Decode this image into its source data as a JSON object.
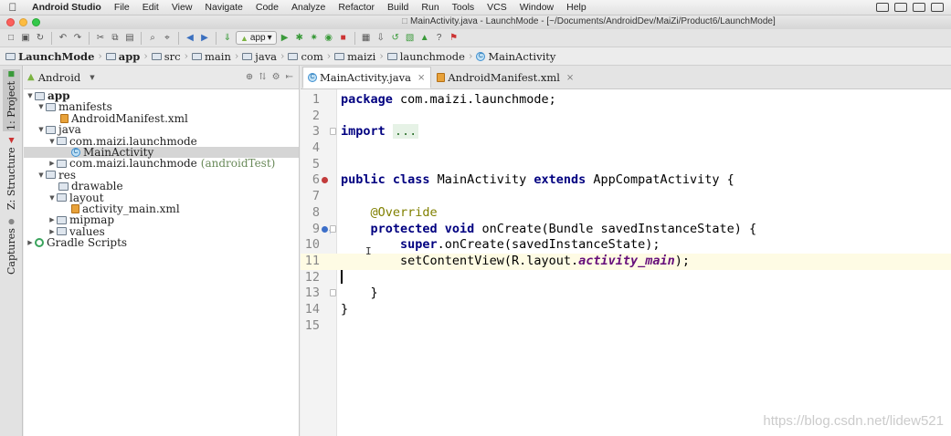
{
  "menubar": {
    "app_name": "Android Studio",
    "items": [
      "File",
      "Edit",
      "View",
      "Navigate",
      "Code",
      "Analyze",
      "Refactor",
      "Build",
      "Run",
      "Tools",
      "VCS",
      "Window",
      "Help"
    ]
  },
  "window": {
    "title": "MainActivity.java - LaunchMode - [~/Documents/AndroidDev/MaiZi/Product6/LaunchMode]"
  },
  "toolbar": {
    "run_config": "app"
  },
  "breadcrumb": [
    "LaunchMode",
    "app",
    "src",
    "main",
    "java",
    "com",
    "maizi",
    "launchmode",
    "MainActivity"
  ],
  "left_stripe": {
    "tabs": [
      "1: Project",
      "Z: Structure",
      "Captures"
    ]
  },
  "project_panel": {
    "view_mode": "Android",
    "tree": [
      {
        "label": "app",
        "depth": 0
      },
      {
        "label": "manifests",
        "depth": 1
      },
      {
        "label": "AndroidManifest.xml",
        "depth": 2
      },
      {
        "label": "java",
        "depth": 1
      },
      {
        "label": "com.maizi.launchmode",
        "depth": 2
      },
      {
        "label": "MainActivity",
        "depth": 3
      },
      {
        "label": "com.maizi.launchmode",
        "suffix": "(androidTest)",
        "depth": 2
      },
      {
        "label": "res",
        "depth": 1
      },
      {
        "label": "drawable",
        "depth": 2
      },
      {
        "label": "layout",
        "depth": 2
      },
      {
        "label": "activity_main.xml",
        "depth": 3
      },
      {
        "label": "mipmap",
        "depth": 2
      },
      {
        "label": "values",
        "depth": 2
      },
      {
        "label": "Gradle Scripts",
        "depth": 0
      }
    ]
  },
  "editor": {
    "tabs": [
      {
        "label": "MainActivity.java",
        "active": true
      },
      {
        "label": "AndroidManifest.xml",
        "active": false
      }
    ],
    "line_numbers": [
      "1",
      "2",
      "3",
      "4",
      "5",
      "6",
      "7",
      "8",
      "9",
      "10",
      "11",
      "12",
      "13",
      "14",
      "15"
    ],
    "code": {
      "l1_kw": "package",
      "l1_rest": " com.maizi.launchmode;",
      "l3_kw": "import",
      "l3_fold": "...",
      "l6_kw1": "public class",
      "l6_mid": " MainActivity ",
      "l6_kw2": "extends",
      "l6_rest": " AppCompatActivity {",
      "l8_ann": "@Override",
      "l9_kw": "protected void",
      "l9_rest": " onCreate(Bundle savedInstanceState) {",
      "l10_kw": "super",
      "l10_rest": ".onCreate(savedInstanceState);",
      "l11_pre": "setContentView(R.layout.",
      "l11_field": "activity_main",
      "l11_post": ");",
      "l13": "}",
      "l14": "}"
    },
    "current_line": 12
  },
  "watermark": "https://blog.csdn.net/lidew521"
}
